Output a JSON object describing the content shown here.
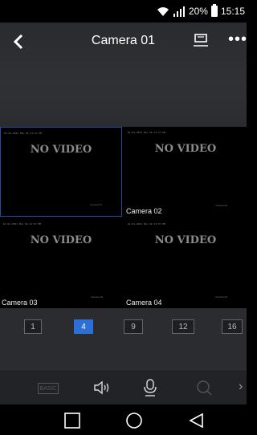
{
  "status_bar": {
    "battery": "20%",
    "time": "15:15"
  },
  "header": {
    "title": "Camera 01"
  },
  "grid": {
    "no_video_text": "NO VIDEO",
    "tiles": [
      {
        "timestamp": "01-01-2021 Mon 01:11:37 PM",
        "label": "",
        "overlay": "Camera 01"
      },
      {
        "timestamp": "01-01-2021 Mon 01:11:37 PM",
        "label": "Camera 02",
        "overlay": "Camera 02"
      },
      {
        "timestamp": "01-01-2021 Mon 01:11:37 PM",
        "label": "Camera 03",
        "overlay": "Camera 03"
      },
      {
        "timestamp": "01-01-2021 Mon 01:11:37 PM",
        "label": "Camera 04",
        "overlay": "Camera 04"
      }
    ]
  },
  "layouts": {
    "options": [
      "1",
      "4",
      "9",
      "12",
      "16"
    ],
    "selected": "4"
  },
  "toolbar": {
    "basic_label": "BASIC"
  },
  "icons": [
    "back-icon",
    "monitor-icon",
    "more-icon",
    "speaker-icon",
    "microphone-icon",
    "zoom-icon",
    "chevron-right-icon",
    "nav-recent-icon",
    "nav-home-icon",
    "nav-back-icon"
  ],
  "colors": {
    "accent": "#2d6fd6",
    "selected_border": "#2a4aa0",
    "background": "#2b2c2f"
  }
}
